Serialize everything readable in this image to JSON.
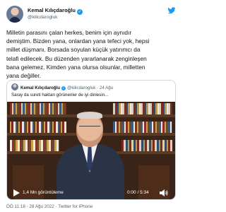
{
  "author": {
    "name": "Kemal Kılıçdaroğlu",
    "handle": "@kilicdarogluk",
    "verified_icon": "verified-badge-icon"
  },
  "tweet": {
    "lines": [
      "Milletin parasını çalan herkes, benim için aynıdır",
      "demiştim. Bizden yana, onlardan yana tefeci yok, hepsi",
      "millet düşmanı. Borsada soyulan küçük yatırımcı da",
      "telafi edilecek. Bu düzenden yararlanarak zenginleşen",
      "bana gelemez. Kimden yana olursa olsunlar, milletten",
      "yana değiller."
    ]
  },
  "quote": {
    "name": "Kemal Kılıçdaroğlu",
    "handle": "@kilicdarogluk",
    "separator": "·",
    "date": "24 Ağu",
    "text": "Saray da sureti haktan görünenler de iyi dinlesin...",
    "video": {
      "views": "1,4 Mn görüntüleme",
      "time": "0:00 / 5:34",
      "play_icon": "play-icon",
      "volume_icon": "speaker-icon"
    }
  },
  "footer": {
    "timestamp": "ÖÖ 11:18 · 28 Ağu 2022 · ",
    "source": "Twitter for iPhone"
  },
  "colors": {
    "accent": "#1d9bf0",
    "text": "#0f1419",
    "muted": "#536471"
  }
}
